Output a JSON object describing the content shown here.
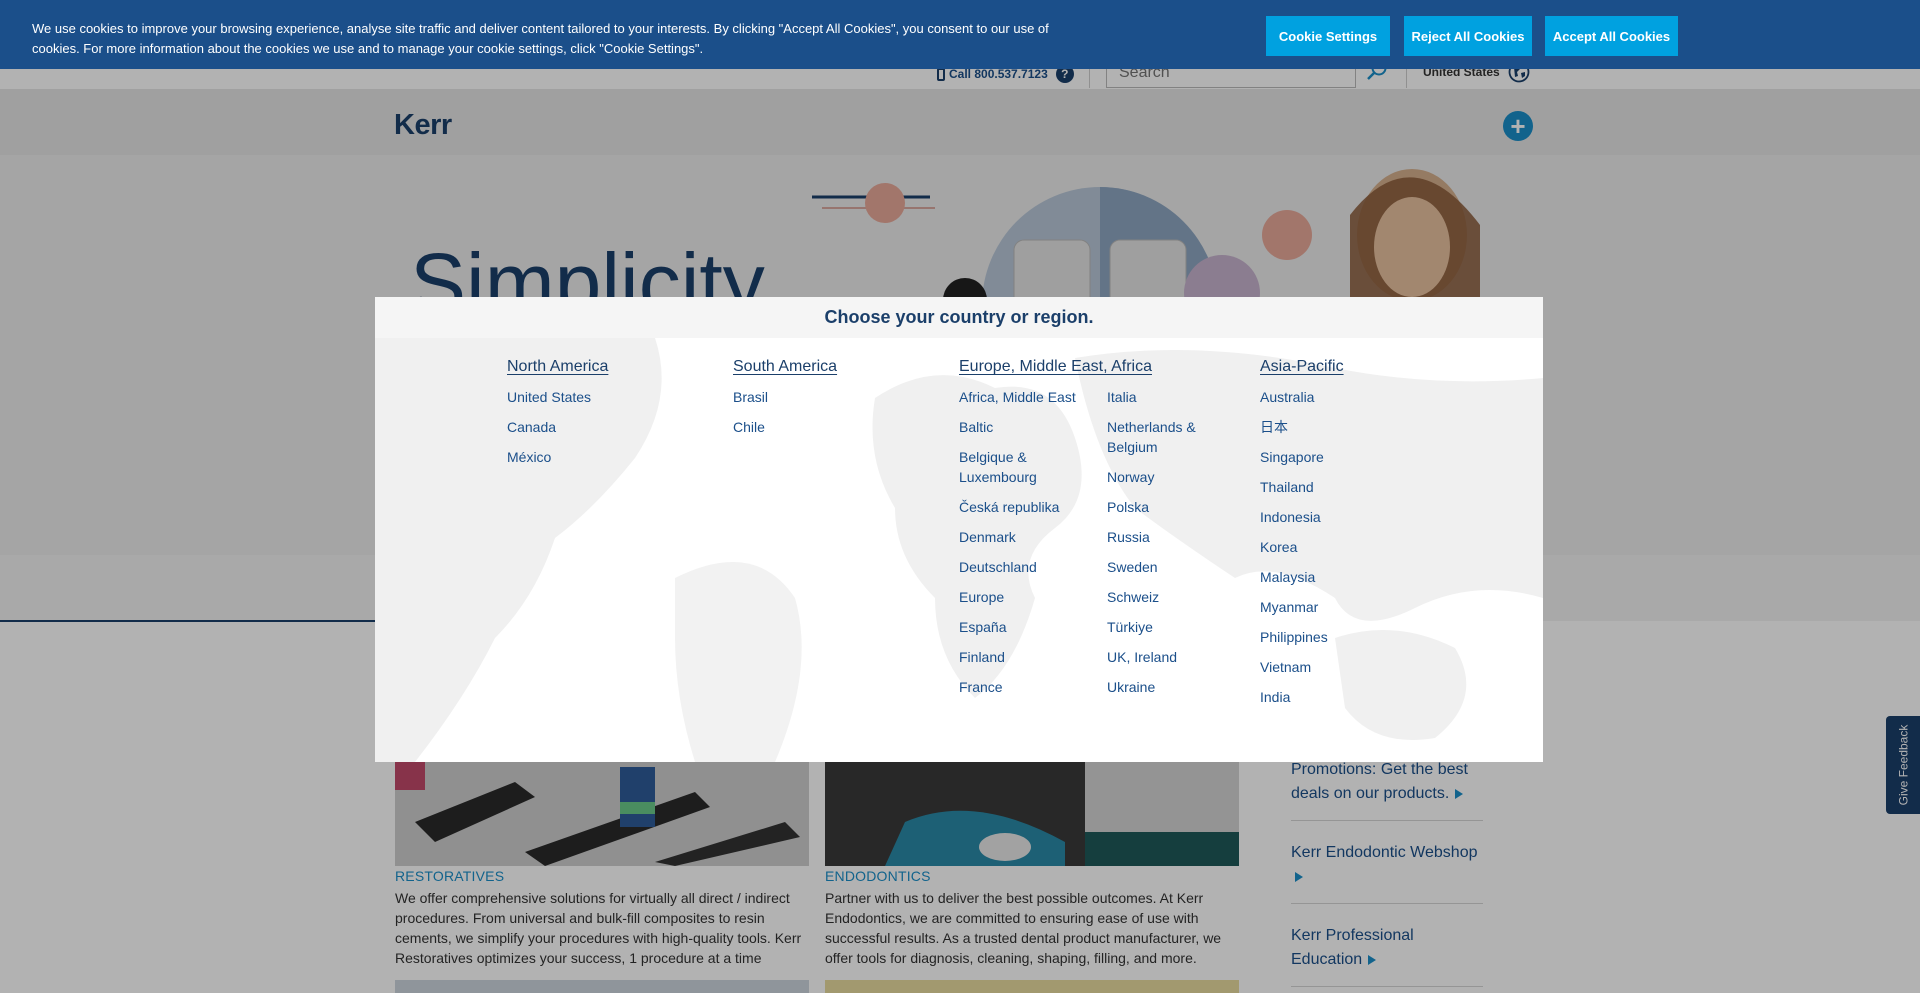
{
  "cookie_banner": {
    "text": "We use cookies to improve your browsing experience, analyse site traffic and deliver content tailored to your interests. By clicking \"Accept All Cookies\", you consent to our use of cookies. For more information about the cookies we use and to manage your cookie settings, click \"Cookie Settings\".",
    "settings_label": "Cookie Settings",
    "reject_label": "Reject All Cookies",
    "accept_label": "Accept All Cookies"
  },
  "utility": {
    "call_text": "Call 800.537.7123",
    "help_glyph": "?",
    "search_placeholder": "Search",
    "region_label": "United States"
  },
  "brand": {
    "logo_text": "Kerr",
    "plus_glyph": "+"
  },
  "hero": {
    "title": "Simplicity"
  },
  "region_modal": {
    "title": "Choose your country or region.",
    "north_america": {
      "heading": "North America",
      "countries": [
        "United States",
        "Canada",
        "México"
      ]
    },
    "south_america": {
      "heading": "South America",
      "countries": [
        "Brasil",
        "Chile"
      ]
    },
    "emea": {
      "heading": "Europe, Middle East, Africa",
      "countries_col1": [
        "Africa, Middle East",
        "Baltic",
        "Belgique & Luxembourg",
        "Česká republika",
        "Denmark",
        "Deutschland",
        "Europe",
        "España",
        "Finland",
        "France"
      ],
      "countries_col2": [
        "Italia",
        "Netherlands & Belgium",
        "Norway",
        "Polska",
        "Russia",
        "Sweden",
        "Schweiz",
        "Türkiye",
        "UK, Ireland",
        "Ukraine"
      ]
    },
    "asia_pacific": {
      "heading": "Asia-Pacific",
      "countries": [
        "Australia",
        "日本",
        "Singapore",
        "Thailand",
        "Indonesia",
        "Korea",
        "Malaysia",
        "Myanmar",
        "Philippines",
        "Vietnam",
        "India"
      ]
    }
  },
  "cards": [
    {
      "label": "RESTORATIVES",
      "text": "We offer comprehensive solutions for virtually all direct / indirect procedures. From universal and bulk-fill composites to resin cements, we simplify your procedures with high-quality tools. Kerr Restoratives optimizes your success, 1 procedure at a time"
    },
    {
      "label": "ENDODONTICS",
      "text": "Partner with us to deliver the best possible outcomes. At Kerr Endodontics, we are committed to ensuring ease of use with successful results. As a trusted dental product manufacturer, we offer tools for diagnosis, cleaning, shaping, filling, and more."
    }
  ],
  "sidebar": {
    "links": [
      "Promotions: Get the best deals on our products.",
      "Kerr Endodontic Webshop",
      "Kerr Professional Education"
    ]
  },
  "feedback": {
    "label": "Give Feedback"
  },
  "colors": {
    "brand_navy": "#1b3f6a",
    "banner_blue": "#1b4f8a",
    "button_cyan": "#00a1e0",
    "link_blue": "#1b4f8a"
  }
}
